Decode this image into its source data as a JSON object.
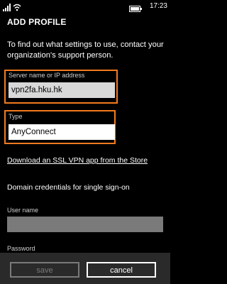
{
  "status": {
    "time": "17:23"
  },
  "title": "ADD PROFILE",
  "intro_text": "To find out what settings to use, contact your organization's support person.",
  "server": {
    "label": "Server name or IP address",
    "value": "vpn2fa.hku.hk"
  },
  "type": {
    "label": "Type",
    "value": "AnyConnect"
  },
  "store_link": "Download an SSL VPN app from the Store",
  "section": "Domain credentials for single sign-on",
  "username": {
    "label": "User name",
    "value": ""
  },
  "password": {
    "label": "Password",
    "value": ""
  },
  "app_bar": {
    "save_label": "save",
    "cancel_label": "cancel"
  },
  "colors": {
    "highlight": "#f37a1f",
    "background": "#000000",
    "field_gray": "#7a7a7a",
    "app_bar": "#2a2a2a"
  }
}
